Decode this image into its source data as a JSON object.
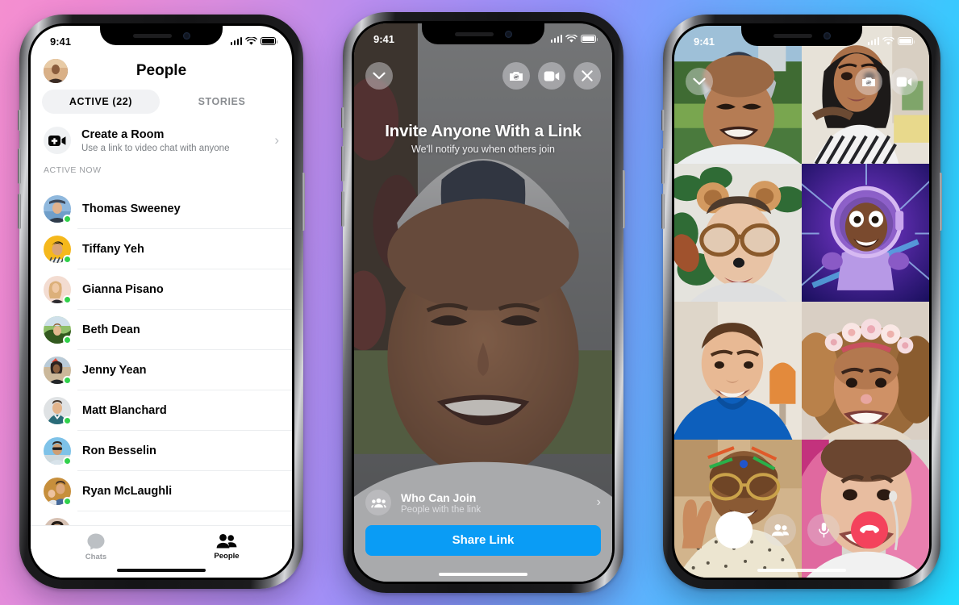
{
  "background": {
    "gradient_from": "#f48fd0",
    "gradient_mid": "#8f93fb",
    "gradient_to": "#22dcff"
  },
  "phone_left": {
    "status": {
      "time": "9:41",
      "signal_icon": "cellular-bars-icon",
      "wifi_icon": "wifi-icon",
      "battery_icon": "battery-full-icon"
    },
    "header": {
      "title": "People",
      "avatar_label": "profile-avatar"
    },
    "tabs": [
      {
        "label": "ACTIVE (22)",
        "active": true
      },
      {
        "label": "STORIES",
        "active": false
      }
    ],
    "create_room": {
      "title": "Create a Room",
      "subtitle": "Use a link to video chat with anyone",
      "icon": "video-plus-icon",
      "chevron": "›"
    },
    "section_label": "ACTIVE NOW",
    "contacts": [
      {
        "name": "Thomas Sweeney",
        "online": true
      },
      {
        "name": "Tiffany Yeh",
        "online": true
      },
      {
        "name": "Gianna Pisano",
        "online": true
      },
      {
        "name": "Beth Dean",
        "online": true
      },
      {
        "name": "Jenny Yean",
        "online": true
      },
      {
        "name": "Matt Blanchard",
        "online": true
      },
      {
        "name": "Ron Besselin",
        "online": true
      },
      {
        "name": "Ryan McLaughli",
        "online": true
      }
    ],
    "tabbar": [
      {
        "label": "Chats",
        "icon": "chat-bubble-icon",
        "active": false
      },
      {
        "label": "People",
        "icon": "people-icon",
        "active": true
      }
    ]
  },
  "phone_middle": {
    "status": {
      "time": "9:41"
    },
    "top_controls": [
      {
        "name": "minimize-chevron-down-icon"
      },
      {
        "name": "flip-camera-icon"
      },
      {
        "name": "video-camera-icon"
      },
      {
        "name": "close-x-icon"
      }
    ],
    "invite": {
      "title": "Invite Anyone With a Link",
      "subtitle": "We'll notify you when others join"
    },
    "who_can_join": {
      "title": "Who Can Join",
      "subtitle": "People with the link",
      "icon": "group-people-icon",
      "chevron": "›"
    },
    "share_button": {
      "label": "Share Link",
      "color": "#0a9cf5"
    }
  },
  "phone_right": {
    "status": {
      "time": "9:41"
    },
    "top_controls": [
      {
        "name": "minimize-chevron-down-icon"
      },
      {
        "name": "flip-camera-icon"
      },
      {
        "name": "video-camera-icon"
      }
    ],
    "participants": [
      {
        "id": 1,
        "description": "man-in-backward-cap-outdoors"
      },
      {
        "id": 2,
        "description": "woman-striped-shirt-indoors"
      },
      {
        "id": 3,
        "description": "man-with-bear-ears-filter"
      },
      {
        "id": 4,
        "description": "astronaut-avatar-filter"
      },
      {
        "id": 5,
        "description": "man-in-blue-hoodie"
      },
      {
        "id": 6,
        "description": "woman-flower-crown-filter"
      },
      {
        "id": 7,
        "description": "woman-peace-sign-filter"
      },
      {
        "id": 8,
        "description": "woman-pink-hair-earbuds"
      }
    ],
    "call_controls": [
      {
        "name": "camera-shutter-button"
      },
      {
        "name": "add-people-icon"
      },
      {
        "name": "microphone-icon"
      },
      {
        "name": "end-call-icon"
      }
    ]
  }
}
